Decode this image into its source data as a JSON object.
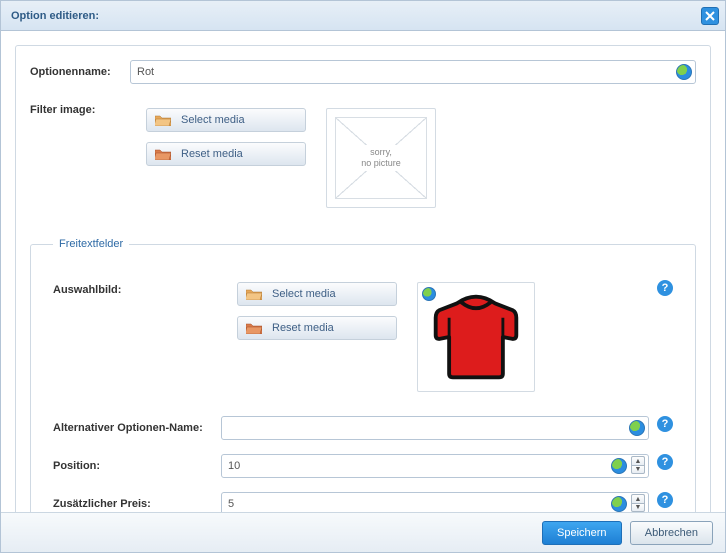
{
  "window": {
    "title": "Option editieren:"
  },
  "optionName": {
    "label": "Optionenname:",
    "value": "Rot"
  },
  "filterImage": {
    "label": "Filter image:",
    "selectMedia": "Select media",
    "resetMedia": "Reset media",
    "noPicture1": "sorry,",
    "noPicture2": "no picture"
  },
  "freetext": {
    "legend": "Freitextfelder",
    "auswahlbild": {
      "label": "Auswahlbild:",
      "selectMedia": "Select media",
      "resetMedia": "Reset media"
    },
    "altName": {
      "label": "Alternativer Optionen-Name:",
      "value": ""
    },
    "position": {
      "label": "Position:",
      "value": "10"
    },
    "price": {
      "label": "Zusätzlicher Preis:",
      "value": "5"
    }
  },
  "footer": {
    "save": "Speichern",
    "cancel": "Abbrechen"
  },
  "help": "?"
}
